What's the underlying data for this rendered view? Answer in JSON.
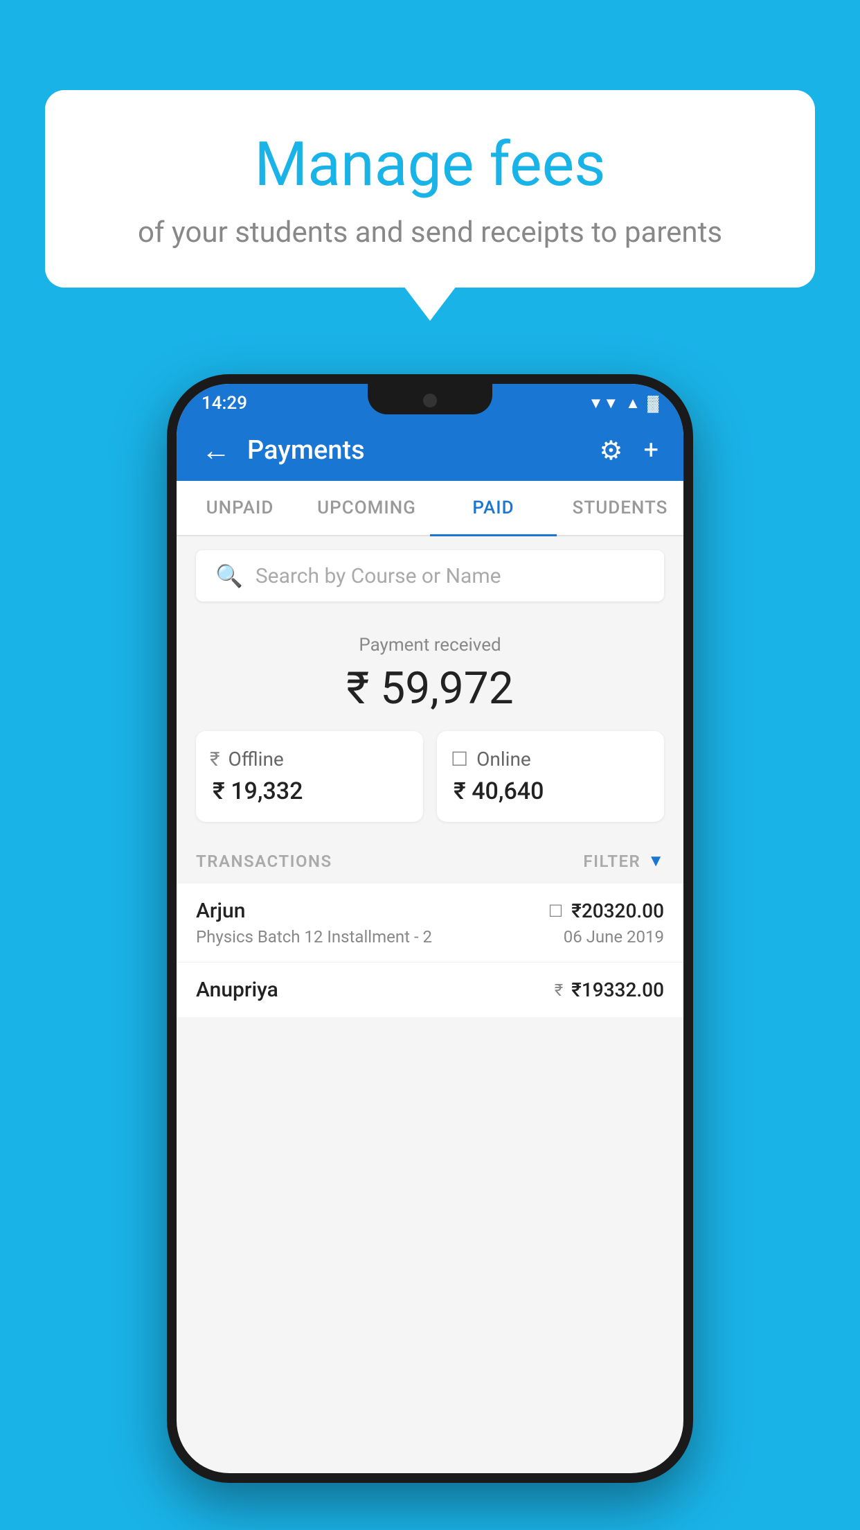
{
  "background_color": "#1ab3e8",
  "speech_bubble": {
    "title": "Manage fees",
    "subtitle": "of your students and send receipts to parents"
  },
  "status_bar": {
    "time": "14:29",
    "wifi": "▲",
    "signal": "▲",
    "battery": "▓"
  },
  "header": {
    "title": "Payments",
    "back_label": "←",
    "gear_label": "⚙",
    "plus_label": "+"
  },
  "tabs": [
    {
      "id": "unpaid",
      "label": "UNPAID",
      "active": false
    },
    {
      "id": "upcoming",
      "label": "UPCOMING",
      "active": false
    },
    {
      "id": "paid",
      "label": "PAID",
      "active": true
    },
    {
      "id": "students",
      "label": "STUDENTS",
      "active": false
    }
  ],
  "search": {
    "placeholder": "Search by Course or Name"
  },
  "payment_summary": {
    "received_label": "Payment received",
    "total_amount": "₹ 59,972",
    "offline": {
      "label": "Offline",
      "amount": "₹ 19,332"
    },
    "online": {
      "label": "Online",
      "amount": "₹ 40,640"
    }
  },
  "transactions_section": {
    "header_label": "TRANSACTIONS",
    "filter_label": "FILTER",
    "rows": [
      {
        "name": "Arjun",
        "description": "Physics Batch 12 Installment - 2",
        "amount": "₹20320.00",
        "date": "06 June 2019",
        "payment_type": "card"
      },
      {
        "name": "Anupriya",
        "description": "",
        "amount": "₹19332.00",
        "date": "",
        "payment_type": "offline"
      }
    ]
  }
}
